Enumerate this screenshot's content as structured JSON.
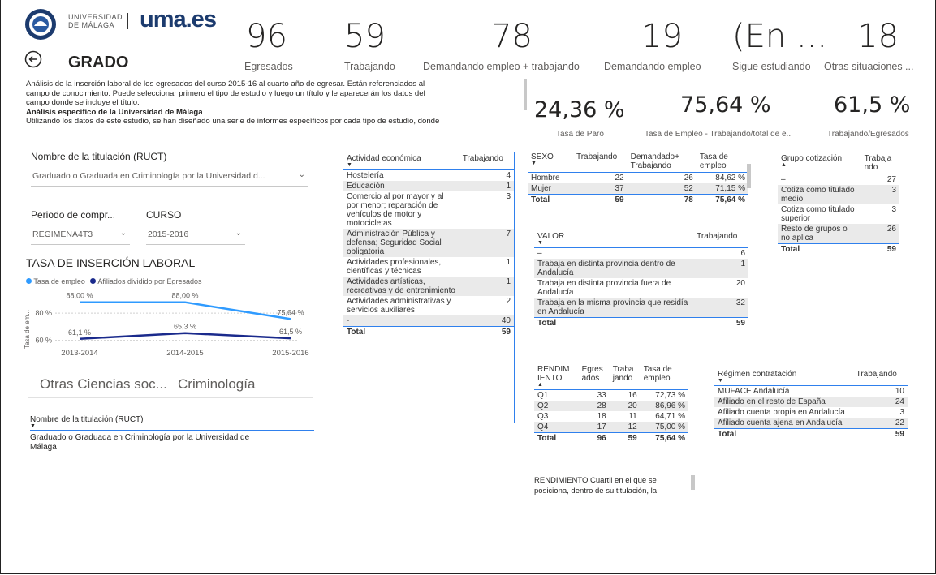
{
  "header": {
    "logo_text_line1": "UNIVERSIDAD",
    "logo_text_line2": "DE MÁLAGA",
    "brand": "uma.es",
    "title": "GRADO"
  },
  "kpis": [
    {
      "value": "96",
      "label": "Egresados"
    },
    {
      "value": "59",
      "label": "Trabajando"
    },
    {
      "value": "78",
      "label": "Demandando empleo + trabajando"
    },
    {
      "value": "19",
      "label": "Demandando empleo"
    },
    {
      "value": "(En ...",
      "label": "Sigue estudiando"
    },
    {
      "value": "18",
      "label": "Otras situaciones ..."
    }
  ],
  "rates": [
    {
      "value": "24,36 %",
      "label": "Tasa de Paro"
    },
    {
      "value": "75,64 %",
      "label": "Tasa de Empleo - Trabajando/total de e..."
    },
    {
      "value": "61,5 %",
      "label": "Trabajando/Egresados"
    }
  ],
  "description": {
    "line1": "Análisis de la inserción laboral de los egresados del curso 2015-16 al cuarto año de egresar.  Están referenciados al",
    "line2": "campo de conocimiento. Puede seleccionar primero el tipo de estudio y luego un título y le aparecerán los datos del",
    "line3": "campo donde se incluye el título.",
    "bold": "Análisis específico de la Universidad de Málaga",
    "line4": "Utilizando los datos de este estudio, se han diseñado una serie de informes específicos por cada tipo de estudio, donde"
  },
  "filters": {
    "titulacion_label": "Nombre de la titulación (RUCT)",
    "titulacion_value": "Graduado o Graduada en Criminología por la Universidad d...",
    "periodo_label": "Periodo de compr...",
    "periodo_value": "REGIMENA4T3",
    "curso_label": "CURSO",
    "curso_value": "2015-2016"
  },
  "chart_title": "TASA DE INSERCIÓN LABORAL",
  "chart_data": {
    "type": "line",
    "categories": [
      "2013-2014",
      "2014-2015",
      "2015-2016"
    ],
    "series": [
      {
        "name": "Tasa de empleo",
        "values": [
          88.0,
          88.0,
          75.64
        ],
        "labels": [
          "88,00 %",
          "88,00 %",
          "75,64 %"
        ],
        "color": "#2f9bff"
      },
      {
        "name": "Afiliados dividido por Egresados",
        "values": [
          61.1,
          65.3,
          61.5
        ],
        "labels": [
          "61,1 %",
          "65,3 %",
          "61,5 %"
        ],
        "color": "#1a2a8c"
      }
    ],
    "ylabel": "Tasa de em...",
    "yticks": [
      "80 %",
      "60 %"
    ],
    "ylim": [
      55,
      92
    ],
    "grid": true,
    "legend_position": "top-left"
  },
  "field_cards": {
    "field": "Otras Ciencias soc...",
    "subfield": "Criminología"
  },
  "ruct_table": {
    "header": "Nombre de la titulación (RUCT)",
    "value_line1": "Graduado o Graduada en Criminología por la Universidad de",
    "value_line2": "Málaga"
  },
  "actividad_table": {
    "headers": [
      "Actividad económica",
      "Trabajando"
    ],
    "rows": [
      [
        "Hostelería",
        "4"
      ],
      [
        "Educación",
        "1"
      ],
      [
        "Comercio al por mayor y al por menor; reparación de vehículos de motor y motocicletas",
        "3"
      ],
      [
        "Administración Pública y defensa; Seguridad Social obligatoria",
        "7"
      ],
      [
        "Actividades profesionales, científicas y técnicas",
        "1"
      ],
      [
        "Actividades artísticas, recreativas y de entrenimiento",
        "1"
      ],
      [
        "Actividades administrativas y servicios auxiliares",
        "2"
      ],
      [
        "-",
        "40"
      ]
    ],
    "total": [
      "Total",
      "59"
    ]
  },
  "sexo_table": {
    "headers": [
      "SEXO",
      "Trabajando",
      "Demandado+ Trabajando",
      "Tasa de empleo"
    ],
    "rows": [
      [
        "Hombre",
        "22",
        "26",
        "84,62 %"
      ],
      [
        "Mujer",
        "37",
        "52",
        "71,15 %"
      ]
    ],
    "total": [
      "Total",
      "59",
      "78",
      "75,64 %"
    ]
  },
  "valor_table": {
    "headers": [
      "VALOR",
      "Trabajando"
    ],
    "rows": [
      [
        "–",
        "6"
      ],
      [
        "Trabaja en distinta provincia dentro de Andalucía",
        "1"
      ],
      [
        "Trabaja en distinta provincia fuera de Andalucía",
        "20"
      ],
      [
        "Trabaja en la misma provincia que residía en Andalucía",
        "32"
      ]
    ],
    "total": [
      "Total",
      "59"
    ]
  },
  "rend_table": {
    "headers": [
      "RENDIM IENTO",
      "Egres ados",
      "Traba jando",
      "Tasa de empleo"
    ],
    "rows": [
      [
        "Q1",
        "33",
        "16",
        "72,73 %"
      ],
      [
        "Q2",
        "28",
        "20",
        "86,96 %"
      ],
      [
        "Q3",
        "18",
        "11",
        "64,71 %"
      ],
      [
        "Q4",
        "17",
        "12",
        "75,00 %"
      ]
    ],
    "total": [
      "Total",
      "96",
      "59",
      "75,64 %"
    ],
    "note_line1": "RENDIMIENTO Cuartil en el que se",
    "note_line2": "posiciona, dentro de su titulación, la"
  },
  "grupo_table": {
    "headers": [
      "Grupo cotización",
      "Trabaja ndo"
    ],
    "rows": [
      [
        "–",
        "27"
      ],
      [
        "Cotiza como titulado medio",
        "3"
      ],
      [
        "Cotiza como titulado superior",
        "3"
      ],
      [
        "Resto de grupos o no aplica",
        "26"
      ]
    ],
    "total": [
      "Total",
      "59"
    ]
  },
  "regimen_table": {
    "headers": [
      "Régimen contratación",
      "Trabajando"
    ],
    "rows": [
      [
        "MUFACE Andalucía",
        "10"
      ],
      [
        "Afiliado en el resto de España",
        "24"
      ],
      [
        "Afiliado cuenta propia en Andalucía",
        "3"
      ],
      [
        "Afiliado cuenta ajena en Andalucía",
        "22"
      ]
    ],
    "total": [
      "Total",
      "59"
    ]
  }
}
